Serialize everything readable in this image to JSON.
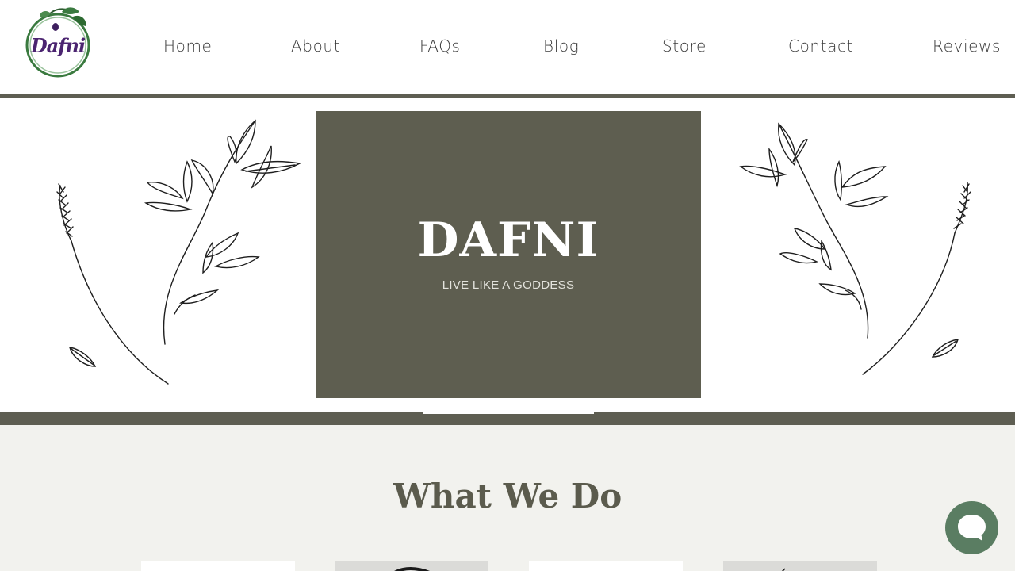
{
  "header": {
    "logo_text": "Dafni",
    "nav": [
      "Home",
      "About",
      "FAQs",
      "Blog",
      "Store",
      "Contact",
      "Reviews"
    ]
  },
  "hero": {
    "title": "DAFNI",
    "subtitle": "LIVE LIKE A GODDESS"
  },
  "section": {
    "title": "What We Do"
  },
  "icons": {
    "logo": "olive-branch-logo",
    "decorations": "botanical-branch-illustration",
    "chat": "chat-bubble-icon"
  },
  "colors": {
    "accent": "#5e5e50",
    "heading": "#5b5b4d",
    "logo_purple": "#4b2470",
    "logo_green": "#3a7a3f",
    "chat": "#5a7d62",
    "background": "#f2f2ee"
  }
}
